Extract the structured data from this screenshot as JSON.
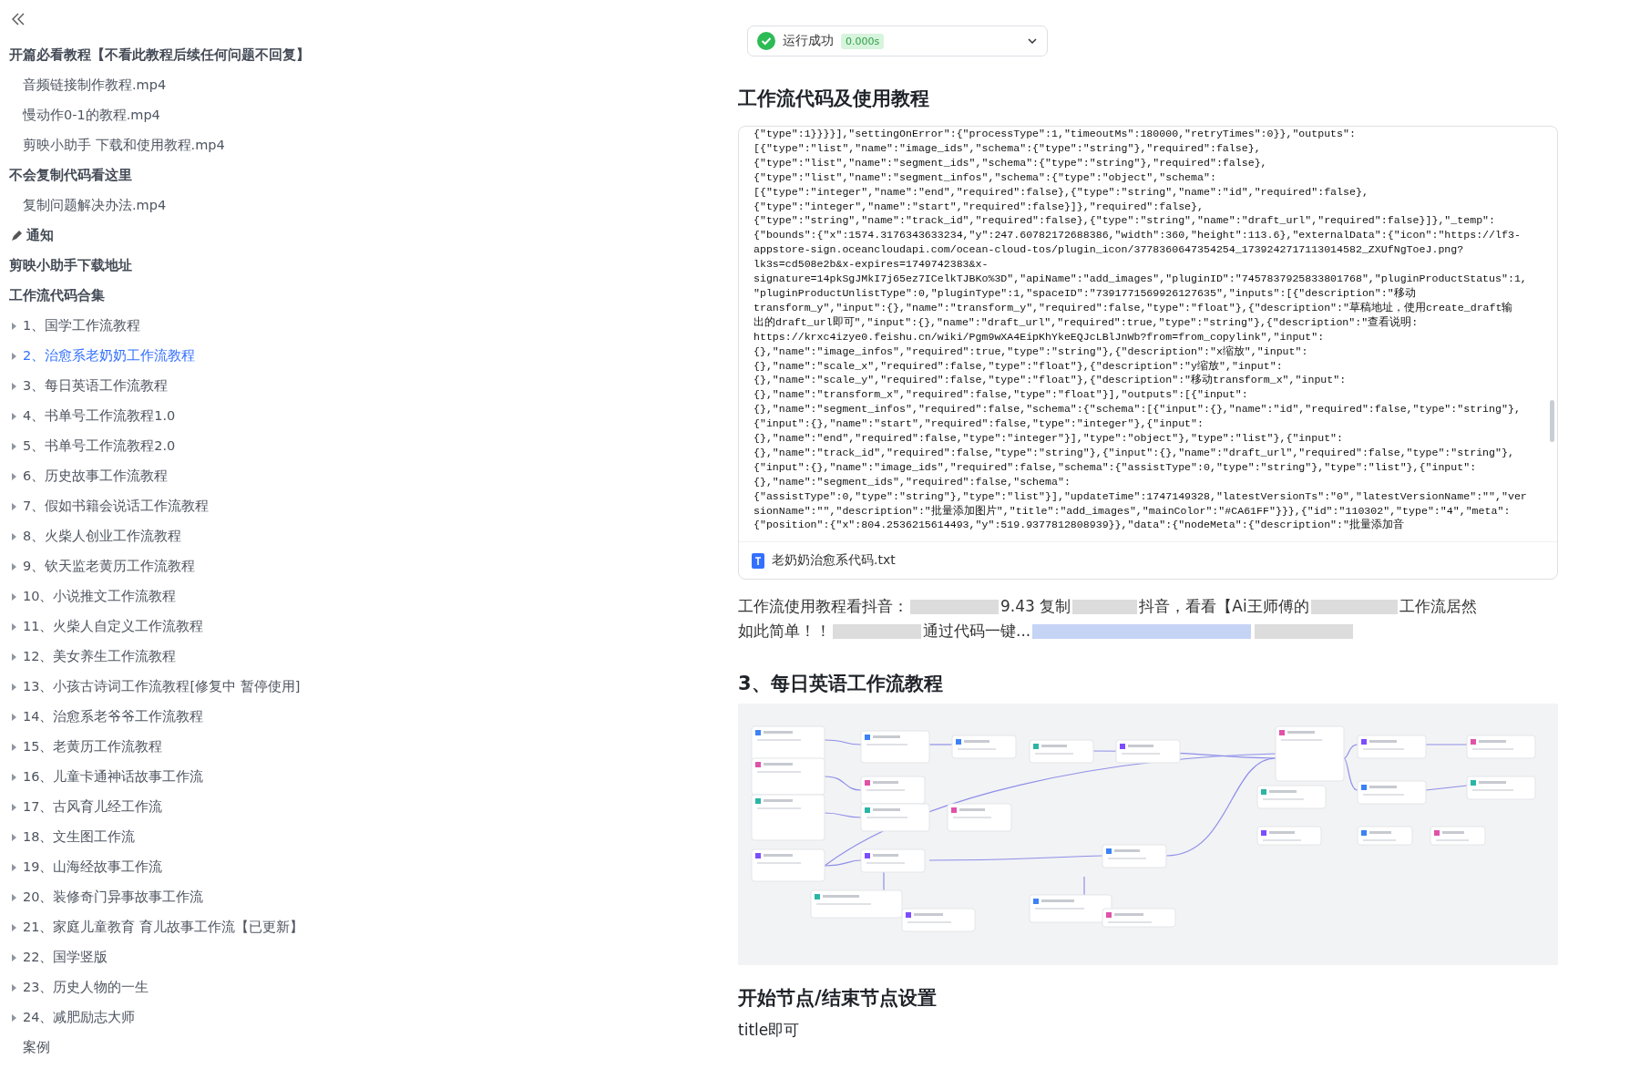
{
  "sidebar": {
    "items": [
      {
        "kind": "heading",
        "label": "开篇必看教程【不看此教程后续任何问题不回复】",
        "selected": false
      },
      {
        "kind": "file",
        "label": "音频链接制作教程.mp4",
        "selected": false
      },
      {
        "kind": "file",
        "label": "慢动作0-1的教程.mp4",
        "selected": false
      },
      {
        "kind": "file",
        "label": "剪映小助手 下载和使用教程.mp4",
        "selected": false
      },
      {
        "kind": "heading",
        "label": "不会复制代码看这里",
        "selected": false
      },
      {
        "kind": "file",
        "label": "复制问题解决办法.mp4",
        "selected": false
      },
      {
        "kind": "notice",
        "label": "通知",
        "selected": false
      },
      {
        "kind": "heading",
        "label": "剪映小助手下载地址",
        "selected": false
      },
      {
        "kind": "heading",
        "label": "工作流代码合集",
        "selected": false
      },
      {
        "kind": "collapsible",
        "label": "1、国学工作流教程",
        "selected": false
      },
      {
        "kind": "collapsible",
        "label": "2、治愈系老奶奶工作流教程",
        "selected": true
      },
      {
        "kind": "collapsible",
        "label": "3、每日英语工作流教程",
        "selected": false
      },
      {
        "kind": "collapsible",
        "label": "4、书单号工作流教程1.0",
        "selected": false
      },
      {
        "kind": "collapsible",
        "label": "5、书单号工作流教程2.0",
        "selected": false
      },
      {
        "kind": "collapsible",
        "label": "6、历史故事工作流教程",
        "selected": false
      },
      {
        "kind": "collapsible",
        "label": "7、假如书籍会说话工作流教程",
        "selected": false
      },
      {
        "kind": "collapsible",
        "label": "8、火柴人创业工作流教程",
        "selected": false
      },
      {
        "kind": "collapsible",
        "label": "9、钦天监老黄历工作流教程",
        "selected": false
      },
      {
        "kind": "collapsible",
        "label": "10、小说推文工作流教程",
        "selected": false
      },
      {
        "kind": "collapsible",
        "label": "11、火柴人自定义工作流教程",
        "selected": false
      },
      {
        "kind": "collapsible",
        "label": "12、美女养生工作流教程",
        "selected": false
      },
      {
        "kind": "collapsible",
        "label": "13、小孩古诗词工作流教程[修复中 暂停使用]",
        "selected": false
      },
      {
        "kind": "collapsible",
        "label": "14、治愈系老爷爷工作流教程",
        "selected": false
      },
      {
        "kind": "collapsible",
        "label": "15、老黄历工作流教程",
        "selected": false
      },
      {
        "kind": "collapsible",
        "label": "16、儿童卡通神话故事工作流",
        "selected": false
      },
      {
        "kind": "collapsible",
        "label": "17、古风育儿经工作流",
        "selected": false
      },
      {
        "kind": "collapsible",
        "label": "18、文生图工作流",
        "selected": false
      },
      {
        "kind": "collapsible",
        "label": "19、山海经故事工作流",
        "selected": false
      },
      {
        "kind": "collapsible",
        "label": "20、装修奇门异事故事工作流",
        "selected": false
      },
      {
        "kind": "collapsible",
        "label": "21、家庭儿童教育 育儿故事工作流【已更新】",
        "selected": false
      },
      {
        "kind": "collapsible",
        "label": "22、国学竖版",
        "selected": false
      },
      {
        "kind": "collapsible",
        "label": "23、历史人物的一生",
        "selected": false
      },
      {
        "kind": "collapsible",
        "label": "24、减肥励志大师",
        "selected": false
      },
      {
        "kind": "file",
        "label": "案例",
        "selected": false
      }
    ]
  },
  "run_status": {
    "label": "运行成功",
    "time": "0.000s"
  },
  "code_section": {
    "title": "工作流代码及使用教程",
    "code_lines": [
      "{\"type\":1}}}}],\"settingOnError\":{\"processType\":1,\"timeoutMs\":180000,\"retryTimes\":0}},\"outputs\":",
      "[{\"type\":\"list\",\"name\":\"image_ids\",\"schema\":{\"type\":\"string\"},\"required\":false},",
      "{\"type\":\"list\",\"name\":\"segment_ids\",\"schema\":{\"type\":\"string\"},\"required\":false},",
      "{\"type\":\"list\",\"name\":\"segment_infos\",\"schema\":{\"type\":\"object\",\"schema\":",
      "[{\"type\":\"integer\",\"name\":\"end\",\"required\":false},{\"type\":\"string\",\"name\":\"id\",\"required\":false},",
      "{\"type\":\"integer\",\"name\":\"start\",\"required\":false}]},\"required\":false},",
      "{\"type\":\"string\",\"name\":\"track_id\",\"required\":false},{\"type\":\"string\",\"name\":\"draft_url\",\"required\":false}]},\"_temp\":",
      "{\"bounds\":{\"x\":1574.3176343633234,\"y\":247.60782172688386,\"width\":360,\"height\":113.6},\"externalData\":{\"icon\":\"https://lf3-",
      "appstore-sign.oceancloudapi.com/ocean-cloud-tos/plugin_icon/3778360647354254_1739242717113014582_ZXUfNgToeJ.png?",
      "lk3s=cd508e2b&x-expires=1749742383&x-",
      "signature=14pkSgJMkI7j65ez7ICelkTJBKo%3D\",\"apiName\":\"add_images\",\"pluginID\":\"7457837925833801768\",\"pluginProductStatus\":1,",
      "\"pluginProductUnlistType\":0,\"pluginType\":1,\"spaceID\":\"7391771569926127635\",\"inputs\":[{\"description\":\"移动",
      "transform_y\",\"input\":{},\"name\":\"transform_y\",\"required\":false,\"type\":\"float\"},{\"description\":\"草稿地址，使用create_draft输",
      "出的draft_url即可\",\"input\":{},\"name\":\"draft_url\",\"required\":true,\"type\":\"string\"},{\"description\":\"查看说明:",
      "https://krxc4izye0.feishu.cn/wiki/Pgm9wXA4EipKhYkeEQJcLBlJnWb?from=from_copylink\",\"input\":",
      "{},\"name\":\"image_infos\",\"required\":true,\"type\":\"string\"},{\"description\":\"x缩放\",\"input\":",
      "{},\"name\":\"scale_x\",\"required\":false,\"type\":\"float\"},{\"description\":\"y缩放\",\"input\":",
      "{},\"name\":\"scale_y\",\"required\":false,\"type\":\"float\"},{\"description\":\"移动transform_x\",\"input\":",
      "{},\"name\":\"transform_x\",\"required\":false,\"type\":\"float\"}],\"outputs\":[{\"input\":",
      "{},\"name\":\"segment_infos\",\"required\":false,\"schema\":{\"schema\":[{\"input\":{},\"name\":\"id\",\"required\":false,\"type\":\"string\"},",
      "{\"input\":{},\"name\":\"start\",\"required\":false,\"type\":\"integer\"},{\"input\":",
      "{},\"name\":\"end\",\"required\":false,\"type\":\"integer\"}],\"type\":\"object\"},\"type\":\"list\"},{\"input\":",
      "{},\"name\":\"track_id\",\"required\":false,\"type\":\"string\"},{\"input\":{},\"name\":\"draft_url\",\"required\":false,\"type\":\"string\"},",
      "{\"input\":{},\"name\":\"image_ids\",\"required\":false,\"schema\":{\"assistType\":0,\"type\":\"string\"},\"type\":\"list\"},{\"input\":",
      "{},\"name\":\"segment_ids\",\"required\":false,\"schema\":",
      "{\"assistType\":0,\"type\":\"string\"},\"type\":\"list\"}],\"updateTime\":1747149328,\"latestVersionTs\":\"0\",\"latestVersionName\":\"\",\"ver",
      "sionName\":\"\",\"description\":\"批量添加图片\",\"title\":\"add_images\",\"mainColor\":\"#CA61FF\"}}},{\"id\":\"110302\",\"type\":\"4\",\"meta\":",
      "{\"position\":{\"x\":804.2536215614493,\"y\":519.9377812808939}},\"data\":{\"nodeMeta\":{\"description\":\"批量添加音"
    ],
    "attachment": "老奶奶治愈系代码.txt"
  },
  "usage_note": {
    "lines": [
      [
        {
          "text": "工作流使用教程看抖音："
        },
        {
          "blurred": true
        },
        {
          "text": "9.43 复制"
        },
        {
          "blurred": true
        },
        {
          "text": "抖音，看看【Ai王师傅的"
        },
        {
          "blurred": true
        },
        {
          "text": "工作流居然"
        }
      ],
      [
        {
          "text": "如此简单！！"
        },
        {
          "blurred": true
        },
        {
          "text": "通过代码一键..."
        },
        {
          "blurred": true,
          "link": true
        },
        {
          "blurred": true
        }
      ]
    ]
  },
  "section_2": {
    "title": "3、每日英语工作流教程"
  },
  "section_3": {
    "title": "开始节点/结束节点设置",
    "body": "title即可"
  }
}
